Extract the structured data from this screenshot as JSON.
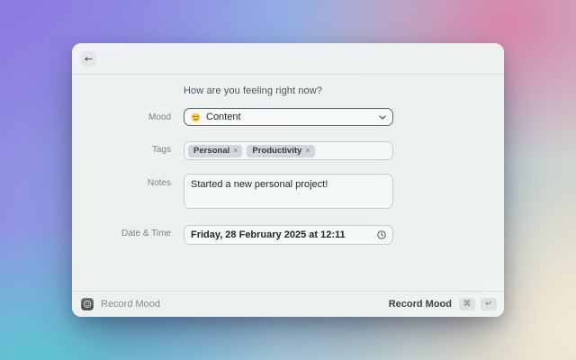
{
  "window": {
    "header": {
      "back_icon": "←"
    },
    "title": "How are you feeling right now?",
    "fields": {
      "mood": {
        "label": "Mood",
        "emoji": "😌",
        "value": "Content"
      },
      "tags": {
        "label": "Tags",
        "chips": [
          {
            "label": "Personal",
            "remove_icon": "×"
          },
          {
            "label": "Productivity",
            "remove_icon": "×"
          }
        ]
      },
      "notes": {
        "label": "Notes",
        "value": "Started a new personal project!"
      },
      "datetime": {
        "label": "Date & Time",
        "value": "Friday, 28 February 2025 at 12:11"
      }
    },
    "footer": {
      "app_name": "Record Mood",
      "primary_action": "Record Mood",
      "shortcuts": [
        "⌘",
        "↵"
      ]
    }
  },
  "colors": {
    "bg_purple": "#8c7ae1",
    "bg_teal": "#58c9d0",
    "bg_pink": "#da80a8",
    "bg_cream": "#f3ebd7",
    "window_bg": "#edf1f0",
    "focus_border": "#5d646b",
    "field_border": "#c7ccd0",
    "chip_bg": "#d2d6d9",
    "emoji_yellow": "#ffcc4d"
  }
}
